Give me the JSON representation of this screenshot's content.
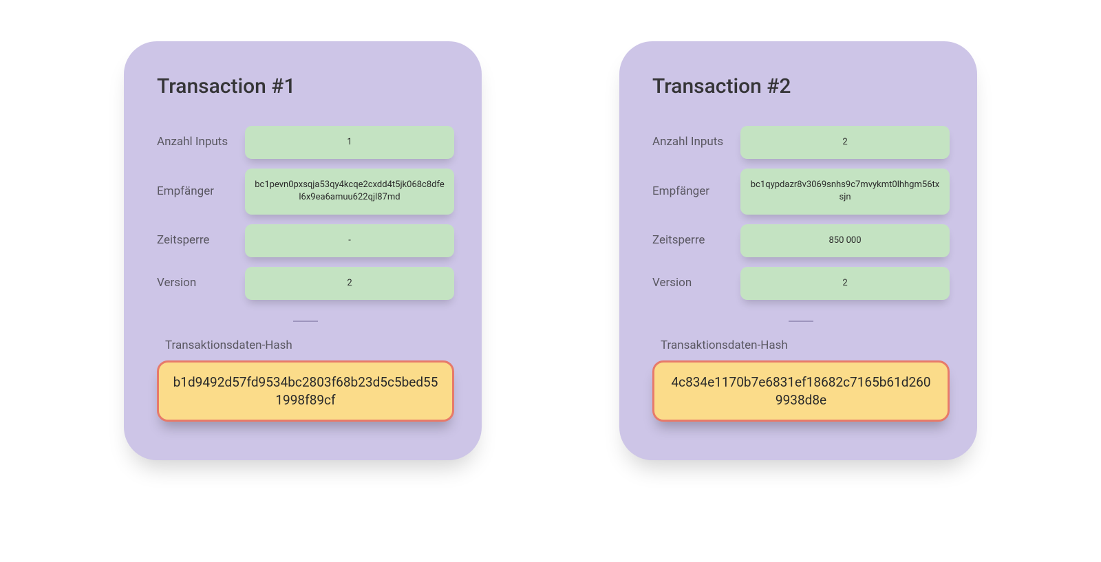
{
  "transactions": [
    {
      "title": "Transaction #1",
      "fields": {
        "inputs_label": "Anzahl Inputs",
        "inputs_value": "1",
        "recipient_label": "Empfänger",
        "recipient_value": "bc1pevn0pxsqja53qy4kcqe2cxdd4t5jk068c8dfel6x9ea6amuu622qjl87md",
        "locktime_label": "Zeitsperre",
        "locktime_value": "-",
        "version_label": "Version",
        "version_value": "2"
      },
      "hash_label": "Transaktionsdaten-Hash",
      "hash_value": "b1d9492d57fd9534bc2803f68b23d5c5bed551998f89cf"
    },
    {
      "title": "Transaction #2",
      "fields": {
        "inputs_label": "Anzahl Inputs",
        "inputs_value": "2",
        "recipient_label": "Empfänger",
        "recipient_value": "bc1qypdazr8v3069snhs9c7mvykmt0lhhgm56txsjn",
        "locktime_label": "Zeitsperre",
        "locktime_value": "850 000",
        "version_label": "Version",
        "version_value": "2"
      },
      "hash_label": "Transaktionsdaten-Hash",
      "hash_value": "4c834e1170b7e6831ef18682c7165b61d2609938d8e"
    }
  ]
}
